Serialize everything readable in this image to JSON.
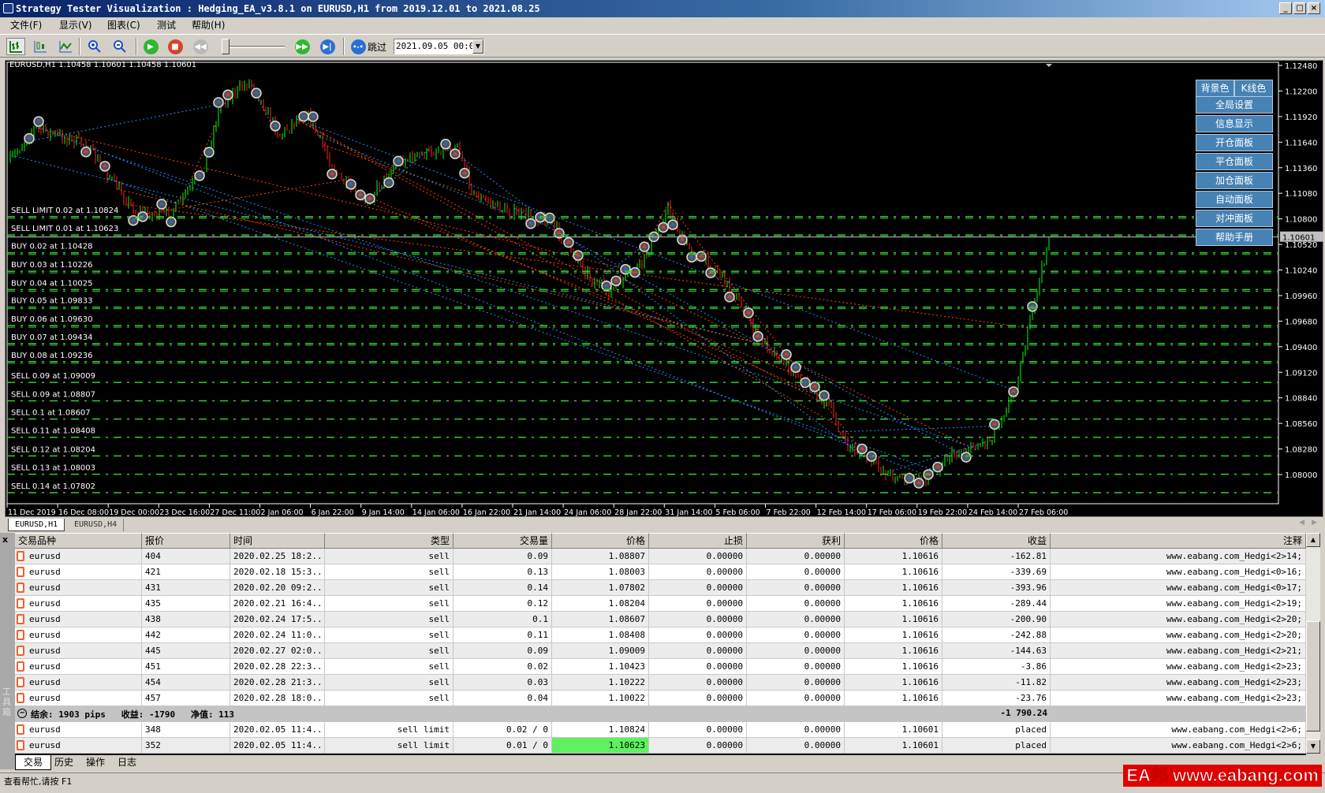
{
  "window": {
    "title": "Strategy Tester Visualization : Hedging_EA_v3.8.1 on EURUSD,H1 from 2019.12.01 to 2021.08.25"
  },
  "menu": [
    "文件(F)",
    "显示(V)",
    "图表(C)",
    "测试",
    "帮助(H)"
  ],
  "toolbar": {
    "skip_label": "跳过",
    "skip_date": "2021.09.05 00:00"
  },
  "chart": {
    "info": "EURUSD,H1  1.10458 1.10601 1.10458 1.10601",
    "y_ticks": [
      "1.12480",
      "1.12200",
      "1.11920",
      "1.11640",
      "1.11360",
      "1.11080",
      "1.10800",
      "1.10520",
      "1.10240",
      "1.09960",
      "1.09680",
      "1.09400",
      "1.09120",
      "1.08840",
      "1.08560",
      "1.08280",
      "1.08000"
    ],
    "x_ticks": [
      "11 Dec 2019",
      "16 Dec 08:00",
      "19 Dec 00:00",
      "23 Dec 16:00",
      "27 Dec 11:00",
      "2 Jan 06:00",
      "6 Jan 22:00",
      "9 Jan 14:00",
      "14 Jan 06:00",
      "16 Jan 22:00",
      "21 Jan 14:00",
      "24 Jan 06:00",
      "28 Jan 22:00",
      "31 Jan 14:00",
      "5 Feb 06:00",
      "7 Feb 22:00",
      "12 Feb 14:00",
      "17 Feb 06:00",
      "19 Feb 22:00",
      "24 Feb 14:00",
      "27 Feb 06:00"
    ],
    "current_price": "1.10601",
    "levels": [
      {
        "label": "SELL LIMIT 0.02 at 1.10824",
        "price": 1.10824
      },
      {
        "label": "SELL LIMIT 0.01 at 1.10623",
        "price": 1.10623
      },
      {
        "label": "BUY 0.02 at 1.10428",
        "price": 1.10428
      },
      {
        "label": "BUY 0.03 at 1.10226",
        "price": 1.10226
      },
      {
        "label": "BUY 0.04 at 1.10025",
        "price": 1.10025
      },
      {
        "label": "BUY 0.05 at 1.09833",
        "price": 1.09833
      },
      {
        "label": "BUY 0.06 at 1.09630",
        "price": 1.0963
      },
      {
        "label": "BUY 0.07 at 1.09434",
        "price": 1.09434
      },
      {
        "label": "BUY 0.08 at 1.09236",
        "price": 1.09236
      },
      {
        "label": "SELL 0.09 at 1.09009",
        "price": 1.09009
      },
      {
        "label": "SELL 0.09 at 1.08807",
        "price": 1.08807
      },
      {
        "label": "SELL 0.1 at 1.08607",
        "price": 1.08607
      },
      {
        "label": "SELL 0.11 at 1.08408",
        "price": 1.08408
      },
      {
        "label": "SELL 0.12 at 1.08204",
        "price": 1.08204
      },
      {
        "label": "SELL 0.13 at 1.08003",
        "price": 1.08003
      },
      {
        "label": "SELL 0.14 at 1.07802",
        "price": 1.07802
      }
    ],
    "colors": {
      "bull": "#00ff00",
      "bear": "#ff2020",
      "level": "#32cd32",
      "panel": "#4682b4"
    }
  },
  "panel": {
    "bg_color": "背景色",
    "candle_color": "K线色",
    "buttons": [
      "全局设置",
      "信息显示",
      "开仓面板",
      "平仓面板",
      "加仓面板",
      "自动面板",
      "对冲面板",
      "帮助手册"
    ]
  },
  "chart_tabs": [
    "EURUSD,H1",
    "EURUSD,H4"
  ],
  "terminal": {
    "side_label": "工具箱",
    "headers": [
      "交易品种",
      "报价",
      "时间",
      "类型",
      "交易量",
      "价格",
      "止损",
      "获利",
      "价格",
      "收益",
      "注释"
    ],
    "positions": [
      [
        "eurusd",
        "404",
        "2020.02.25 18:2...",
        "sell",
        "0.09",
        "1.08807",
        "0.00000",
        "0.00000",
        "1.10616",
        "-162.81",
        "www.eabang.com_Hedgi<2>14;"
      ],
      [
        "eurusd",
        "421",
        "2020.02.18 15:3...",
        "sell",
        "0.13",
        "1.08003",
        "0.00000",
        "0.00000",
        "1.10616",
        "-339.69",
        "www.eabang.com_Hedgi<0>16;"
      ],
      [
        "eurusd",
        "431",
        "2020.02.20 09:2...",
        "sell",
        "0.14",
        "1.07802",
        "0.00000",
        "0.00000",
        "1.10616",
        "-393.96",
        "www.eabang.com_Hedgi<0>17;"
      ],
      [
        "eurusd",
        "435",
        "2020.02.21 16:4...",
        "sell",
        "0.12",
        "1.08204",
        "0.00000",
        "0.00000",
        "1.10616",
        "-289.44",
        "www.eabang.com_Hedgi<2>19;"
      ],
      [
        "eurusd",
        "438",
        "2020.02.24 17:5...",
        "sell",
        "0.1",
        "1.08607",
        "0.00000",
        "0.00000",
        "1.10616",
        "-200.90",
        "www.eabang.com_Hedgi<2>20;"
      ],
      [
        "eurusd",
        "442",
        "2020.02.24 11:0...",
        "sell",
        "0.11",
        "1.08408",
        "0.00000",
        "0.00000",
        "1.10616",
        "-242.88",
        "www.eabang.com_Hedgi<2>20;"
      ],
      [
        "eurusd",
        "445",
        "2020.02.27 02:0...",
        "sell",
        "0.09",
        "1.09009",
        "0.00000",
        "0.00000",
        "1.10616",
        "-144.63",
        "www.eabang.com_Hedgi<2>21;"
      ],
      [
        "eurusd",
        "451",
        "2020.02.28 22:3...",
        "sell",
        "0.02",
        "1.10423",
        "0.00000",
        "0.00000",
        "1.10616",
        "-3.86",
        "www.eabang.com_Hedgi<2>23;"
      ],
      [
        "eurusd",
        "454",
        "2020.02.28 21:3...",
        "sell",
        "0.03",
        "1.10222",
        "0.00000",
        "0.00000",
        "1.10616",
        "-11.82",
        "www.eabang.com_Hedgi<2>23;"
      ],
      [
        "eurusd",
        "457",
        "2020.02.28 18:0...",
        "sell",
        "0.04",
        "1.10022",
        "0.00000",
        "0.00000",
        "1.10616",
        "-23.76",
        "www.eabang.com_Hedgi<2>23;"
      ]
    ],
    "summary": {
      "text": "结余: 1903 pips   收益: -1790   净值: 113",
      "profit": "-1 790.24"
    },
    "orders": [
      [
        "eurusd",
        "348",
        "2020.02.05 11:4...",
        "sell limit",
        "0.02 / 0",
        "1.10824",
        "0.00000",
        "0.00000",
        "1.10601",
        "placed",
        "www.eabang.com_Hedgi<2>6;"
      ],
      [
        "eurusd",
        "352",
        "2020.02.05 11:4...",
        "sell limit",
        "0.01 / 0",
        "1.10623",
        "0.00000",
        "0.00000",
        "1.10601",
        "placed",
        "www.eabang.com_Hedgi<2>6;"
      ]
    ],
    "tabs": [
      "交易",
      "历史",
      "操作",
      "日志"
    ]
  },
  "status": {
    "help": "查看帮忙,请按 F1",
    "watermark": "EA邦 www.eabang.com"
  }
}
